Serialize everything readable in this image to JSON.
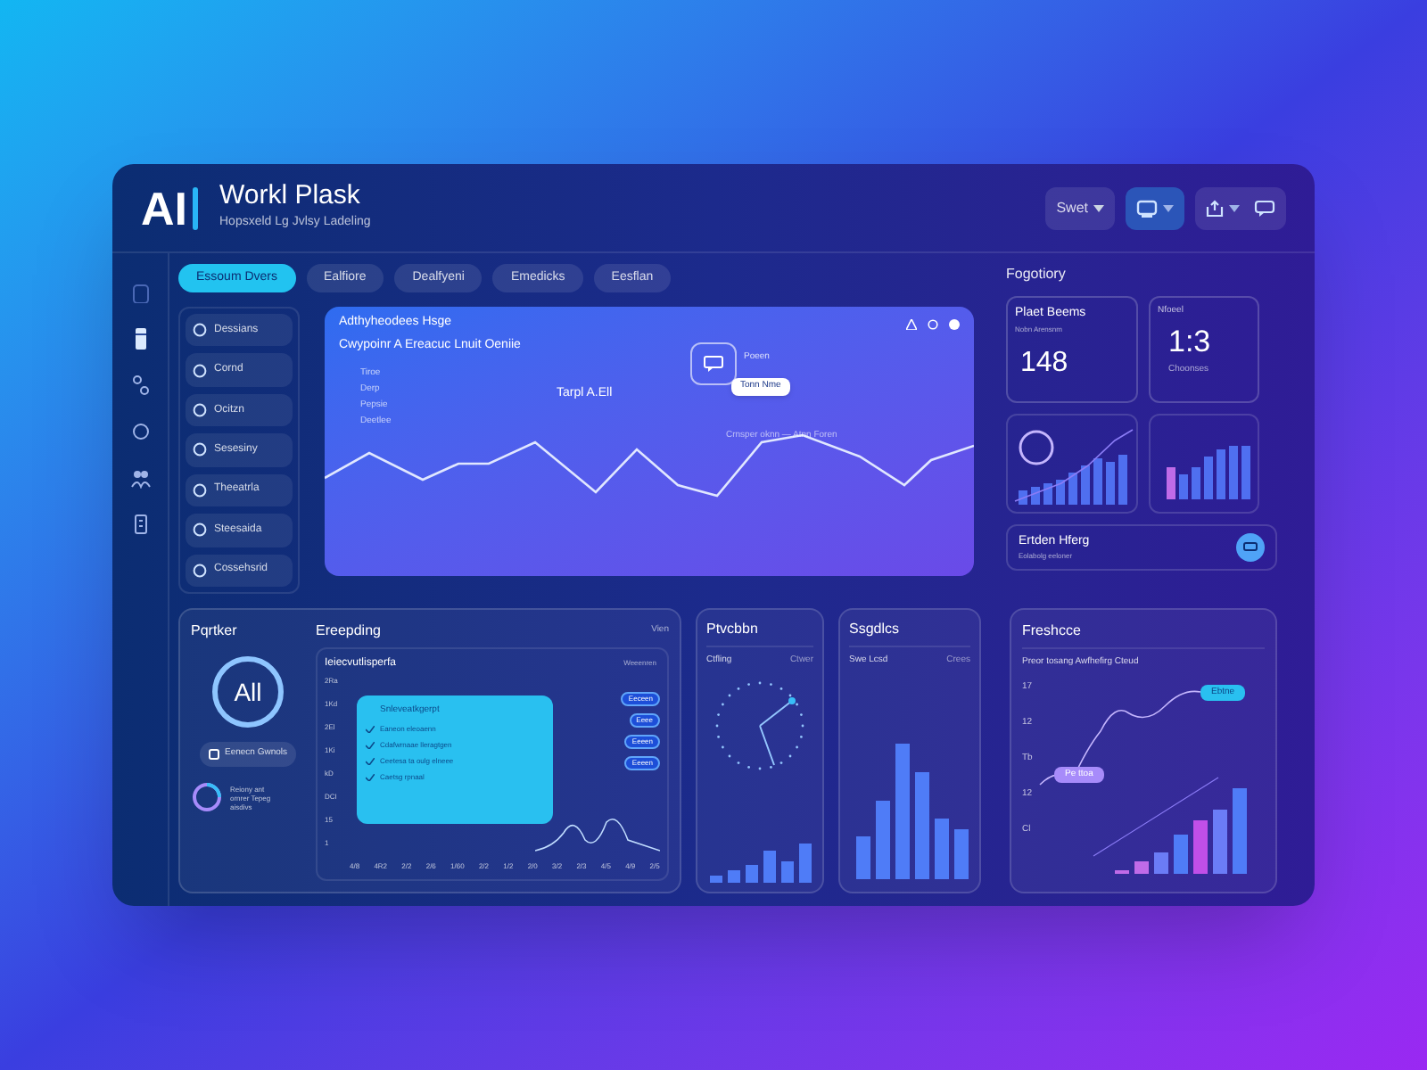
{
  "app": {
    "logo": "AI",
    "title": "Workl Plask",
    "subtitle": "Hopsxeld Lg Jvlsy Ladeling"
  },
  "header_controls": [
    {
      "kind": "dropdown",
      "label": "Swet"
    },
    {
      "kind": "icon"
    },
    {
      "kind": "icon-pair"
    }
  ],
  "tabs": [
    {
      "label": "Essoum Dvers",
      "selected": true
    },
    {
      "label": "Ealfiore",
      "selected": false
    },
    {
      "label": "Dealfyeni",
      "selected": false
    },
    {
      "label": "Emedicks",
      "selected": false
    },
    {
      "label": "Eesflan",
      "selected": false
    }
  ],
  "menu": [
    {
      "label": "Dessians"
    },
    {
      "label": "Cornd"
    },
    {
      "label": "Ocitzn"
    },
    {
      "label": "Sesesiny"
    },
    {
      "label": "Theeatrla"
    },
    {
      "label": "Steesaida"
    },
    {
      "label": "Cossehsrid"
    }
  ],
  "hero": {
    "title": "Adthyheodees Hsge",
    "subtitle": "Cwypoinr A Ereacuc Lnuit Oeniie",
    "list": [
      "Tiroe",
      "Derp",
      "Pepsie",
      "Deetlee"
    ],
    "center_label": "Tarpl A.Ell",
    "icon_label": "Poeen",
    "popup": "Tonn Nme",
    "legend": "Crnsper oknn — Atnn Foren"
  },
  "category": {
    "title": "Fogotiory",
    "card_left": {
      "title": "Plaet Beems",
      "subtitle": "Nobn Arensnm",
      "value": "148"
    },
    "card_right": {
      "title": "Nfoeel",
      "value": "1:3",
      "caption": "Choonses"
    },
    "footer": {
      "title": "Ertden Hferg",
      "subtitle": "Eolabolg eeloner"
    }
  },
  "profile": {
    "title": "Pqrtker",
    "badge": "All",
    "button": "Eenecn Gwnols",
    "note": "Reiony ant ornrer Tepeg aisdivs"
  },
  "trend": {
    "title": "Ereepding",
    "action": "Vien",
    "chart_title": "Ieiecvutlisperfa",
    "legend": "Weeenren",
    "y_labels": [
      "2Ra",
      "1Kd",
      "2El",
      "1Ki",
      "kD",
      "DCI",
      "15",
      "1"
    ],
    "x_labels": [
      "4/8",
      "4R2",
      "2/2",
      "2/6",
      "1/60",
      "2/2",
      "1/2",
      "2/0",
      "3/2",
      "2/3",
      "4/5",
      "4/9",
      "2/5"
    ],
    "overlay": {
      "title": "Snleveatkgerpt",
      "items": [
        "Eaneon eleoaenn",
        "Cdafwrnaae lleragtgen",
        "Ceetesa ta oulg elneee",
        "Caetsg rpnaal"
      ]
    },
    "tags": [
      "Eeceen",
      "Eeee",
      "Eeeen",
      "Eeeen"
    ]
  },
  "pickup": {
    "title": "Ptvcbbn",
    "tab_left": "Ctfling",
    "tab_right": "Ctwer"
  },
  "statistics": {
    "title": "Ssgdlcs",
    "tab_left": "Swe Lcsd",
    "tab_right": "Crees"
  },
  "freshness": {
    "title": "Freshcce",
    "subtitle": "Preor tosang Awfhefirg Cteud",
    "y_labels": [
      "17",
      "12",
      "Tb",
      "12",
      "Cl"
    ],
    "chip": "Ebtne",
    "callout": "Pe ttoa"
  }
}
